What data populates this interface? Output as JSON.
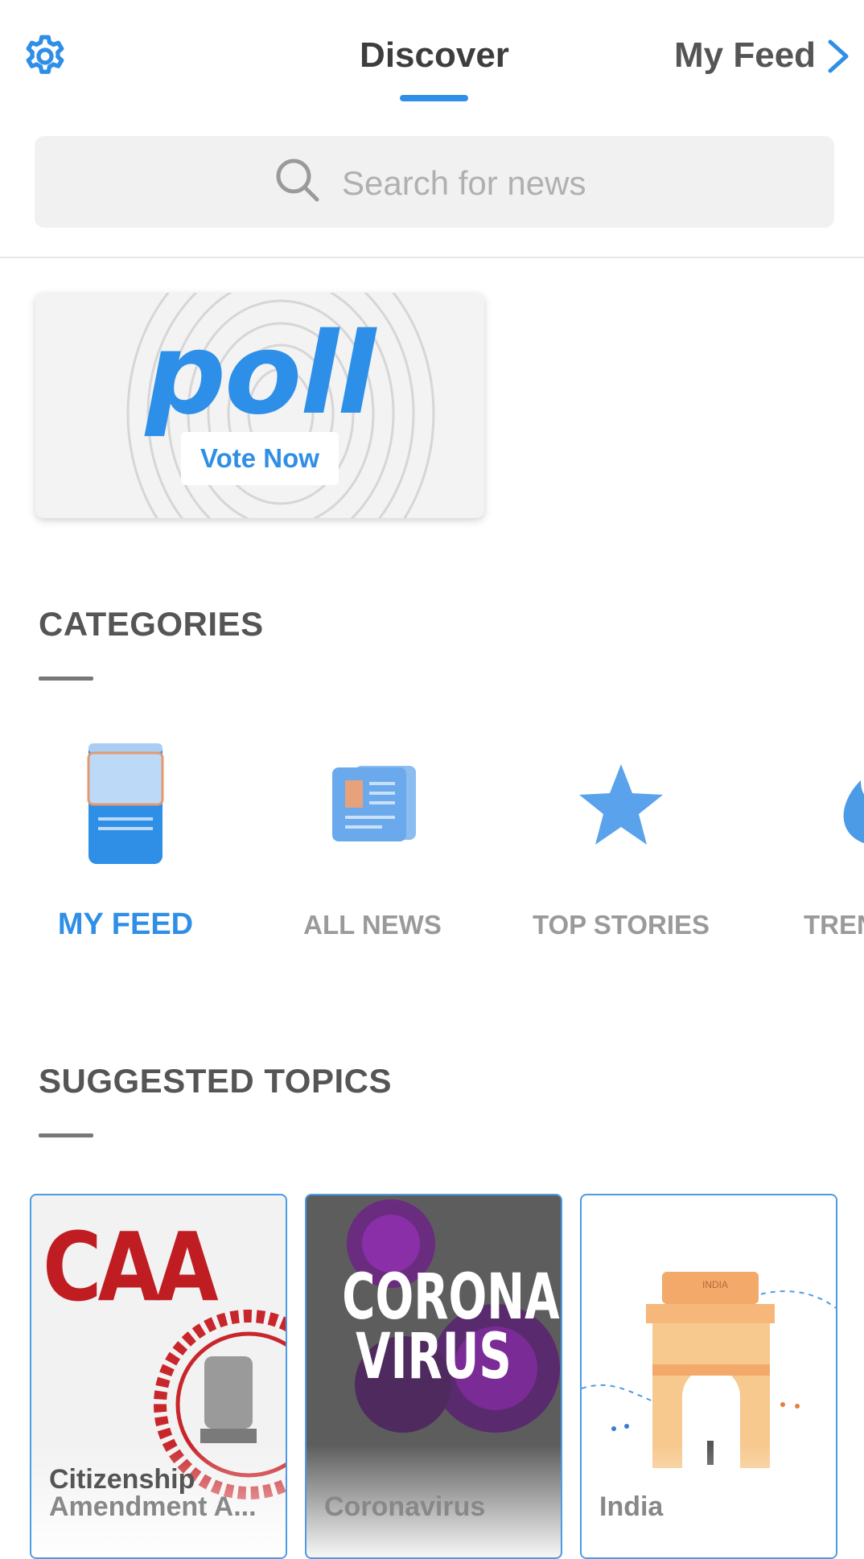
{
  "header": {
    "tab_discover": "Discover",
    "tab_myfeed": "My Feed"
  },
  "search": {
    "placeholder": "Search for news"
  },
  "poll": {
    "word": "poll",
    "cta": "Vote Now"
  },
  "categories": {
    "heading": "CATEGORIES",
    "items": [
      {
        "label": "MY FEED",
        "icon": "feed-icon",
        "active": true
      },
      {
        "label": "ALL NEWS",
        "icon": "newspaper-icon",
        "active": false
      },
      {
        "label": "TOP STORIES",
        "icon": "star-icon",
        "active": false
      },
      {
        "label": "TRENDING",
        "icon": "flame-icon",
        "active": false
      }
    ]
  },
  "suggested": {
    "heading": "SUGGESTED TOPICS",
    "items": [
      {
        "title_line1": "Citizenship",
        "title_line2": "Amendment A...",
        "image_text": "CAA"
      },
      {
        "title_line1": "Coronavirus",
        "image_text_line1": "CORONA",
        "image_text_line2": "VIRUS"
      },
      {
        "title_line1": "India",
        "image_text": "INDIA"
      }
    ]
  },
  "colors": {
    "accent": "#2f8fe6",
    "text": "#555555",
    "muted": "#9a9a9a"
  }
}
